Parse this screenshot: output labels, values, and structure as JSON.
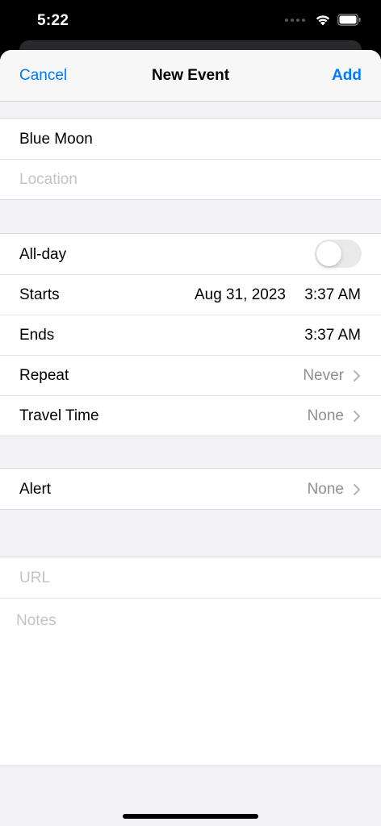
{
  "status_bar": {
    "time": "5:22",
    "icons": [
      "cellular-dots-icon",
      "wifi-icon",
      "battery-icon"
    ]
  },
  "nav": {
    "cancel": "Cancel",
    "title": "New Event",
    "add": "Add"
  },
  "event": {
    "title_value": "Blue Moon",
    "location_placeholder": "Location"
  },
  "timing": {
    "allday_label": "All-day",
    "allday_on": false,
    "starts_label": "Starts",
    "starts_date": "Aug 31, 2023",
    "starts_time": "3:37 AM",
    "ends_label": "Ends",
    "ends_time": "3:37 AM",
    "repeat_label": "Repeat",
    "repeat_value": "Never",
    "travel_label": "Travel Time",
    "travel_value": "None"
  },
  "alert": {
    "label": "Alert",
    "value": "None"
  },
  "extra": {
    "url_placeholder": "URL",
    "notes_placeholder": "Notes"
  },
  "colors": {
    "accent": "#007aff",
    "detail": "#8e8e93",
    "placeholder": "#c4c4c6",
    "background": "#f2f2f7"
  }
}
